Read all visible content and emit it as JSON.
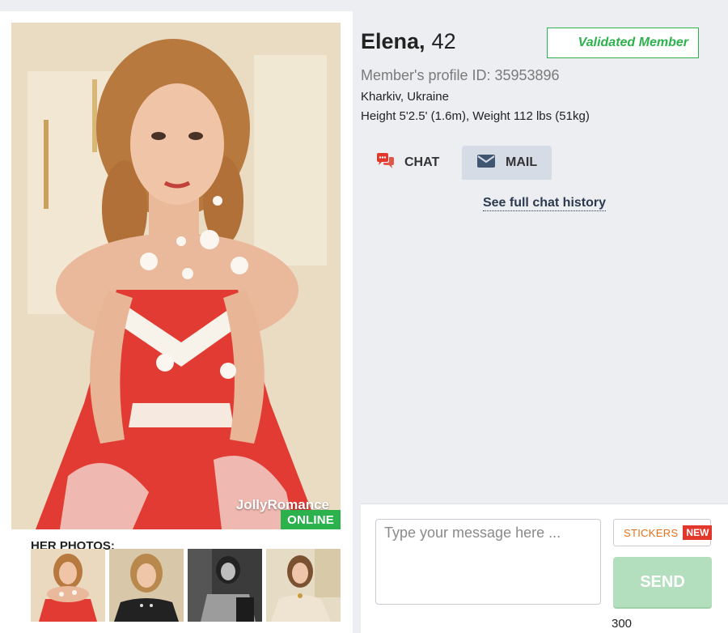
{
  "profile": {
    "name": "Elena,",
    "age": "42",
    "validated_label": "Validated Member",
    "profile_id_text": "Member's profile ID: 35953896",
    "location": "Kharkiv, Ukraine",
    "measurements": "Height 5'2.5' (1.6m), Weight 112 lbs (51kg)"
  },
  "photo": {
    "watermark": "JollyRomance",
    "status_badge": "ONLINE"
  },
  "photos_section": {
    "heading": "HER PHOTOS:",
    "thumbnails": [
      "photo-1",
      "photo-2",
      "photo-3",
      "photo-4"
    ]
  },
  "tabs": [
    {
      "label": "CHAT",
      "icon": "chat-bubbles-icon",
      "active": true
    },
    {
      "label": "MAIL",
      "icon": "envelope-icon",
      "active": false
    }
  ],
  "chat": {
    "history_link": "See full chat history"
  },
  "compose": {
    "placeholder": "Type your message here ...",
    "stickers_label": "STICKERS",
    "new_badge": "NEW",
    "send_label": "SEND",
    "char_count": "300"
  },
  "colors": {
    "online_green": "#2bb24c",
    "validated_green": "#2bb24c",
    "stickers_orange": "#e8701a",
    "new_red": "#e2382b",
    "send_disabled": "#b4dfbe",
    "mail_tab_bg": "#d6dce5"
  }
}
